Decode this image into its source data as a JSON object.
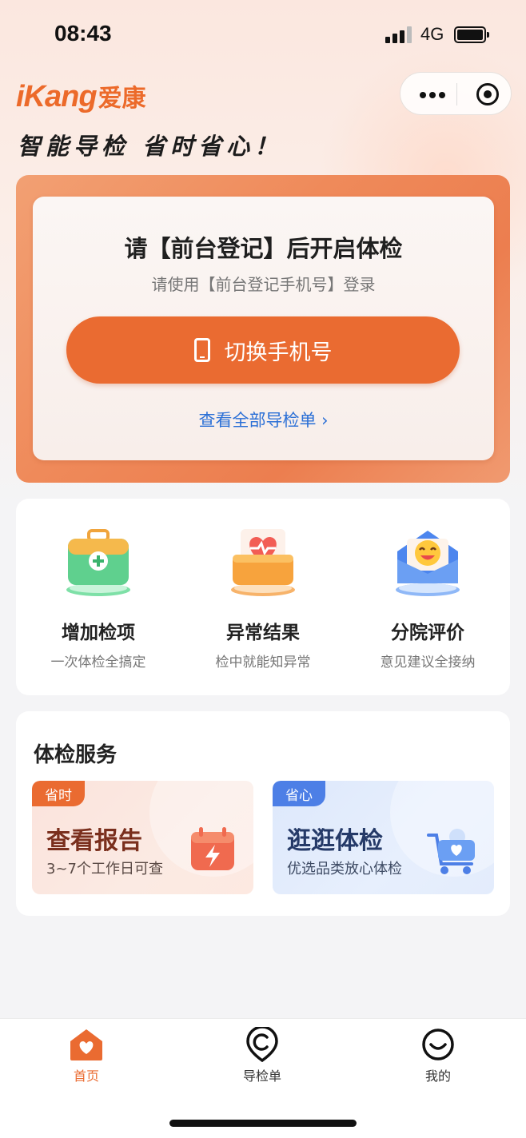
{
  "status_bar": {
    "time": "08:43",
    "network": "4G"
  },
  "header": {
    "logo_en": "iKang",
    "logo_cn": "爱康",
    "slogan": "智能导检 省时省心！"
  },
  "login_card": {
    "title": "请【前台登记】后开启体检",
    "subtitle": "请使用【前台登记手机号】登录",
    "switch_button": "切换手机号",
    "view_all_link": "查看全部导检单 ›"
  },
  "features": [
    {
      "title": "增加检项",
      "subtitle": "一次体检全搞定",
      "icon": "medical-kit-icon"
    },
    {
      "title": "异常结果",
      "subtitle": "检中就能知异常",
      "icon": "heart-report-icon"
    },
    {
      "title": "分院评价",
      "subtitle": "意见建议全接纳",
      "icon": "smile-envelope-icon"
    }
  ],
  "services": {
    "title": "体检服务",
    "items": [
      {
        "tag": "省时",
        "title": "查看报告",
        "subtitle": "3~7个工作日可查",
        "icon": "calendar-bolt-icon"
      },
      {
        "tag": "省心",
        "title": "逛逛体检",
        "subtitle": "优选品类放心体检",
        "icon": "shopping-cart-icon"
      }
    ]
  },
  "tabbar": [
    {
      "label": "首页",
      "icon": "home-heart-icon",
      "active": true
    },
    {
      "label": "导检单",
      "icon": "guide-pin-icon",
      "active": false
    },
    {
      "label": "我的",
      "icon": "smile-face-icon",
      "active": false
    }
  ],
  "colors": {
    "accent": "#ea6b31",
    "link": "#2a6fd6",
    "blue_tag": "#4d7fe6"
  }
}
